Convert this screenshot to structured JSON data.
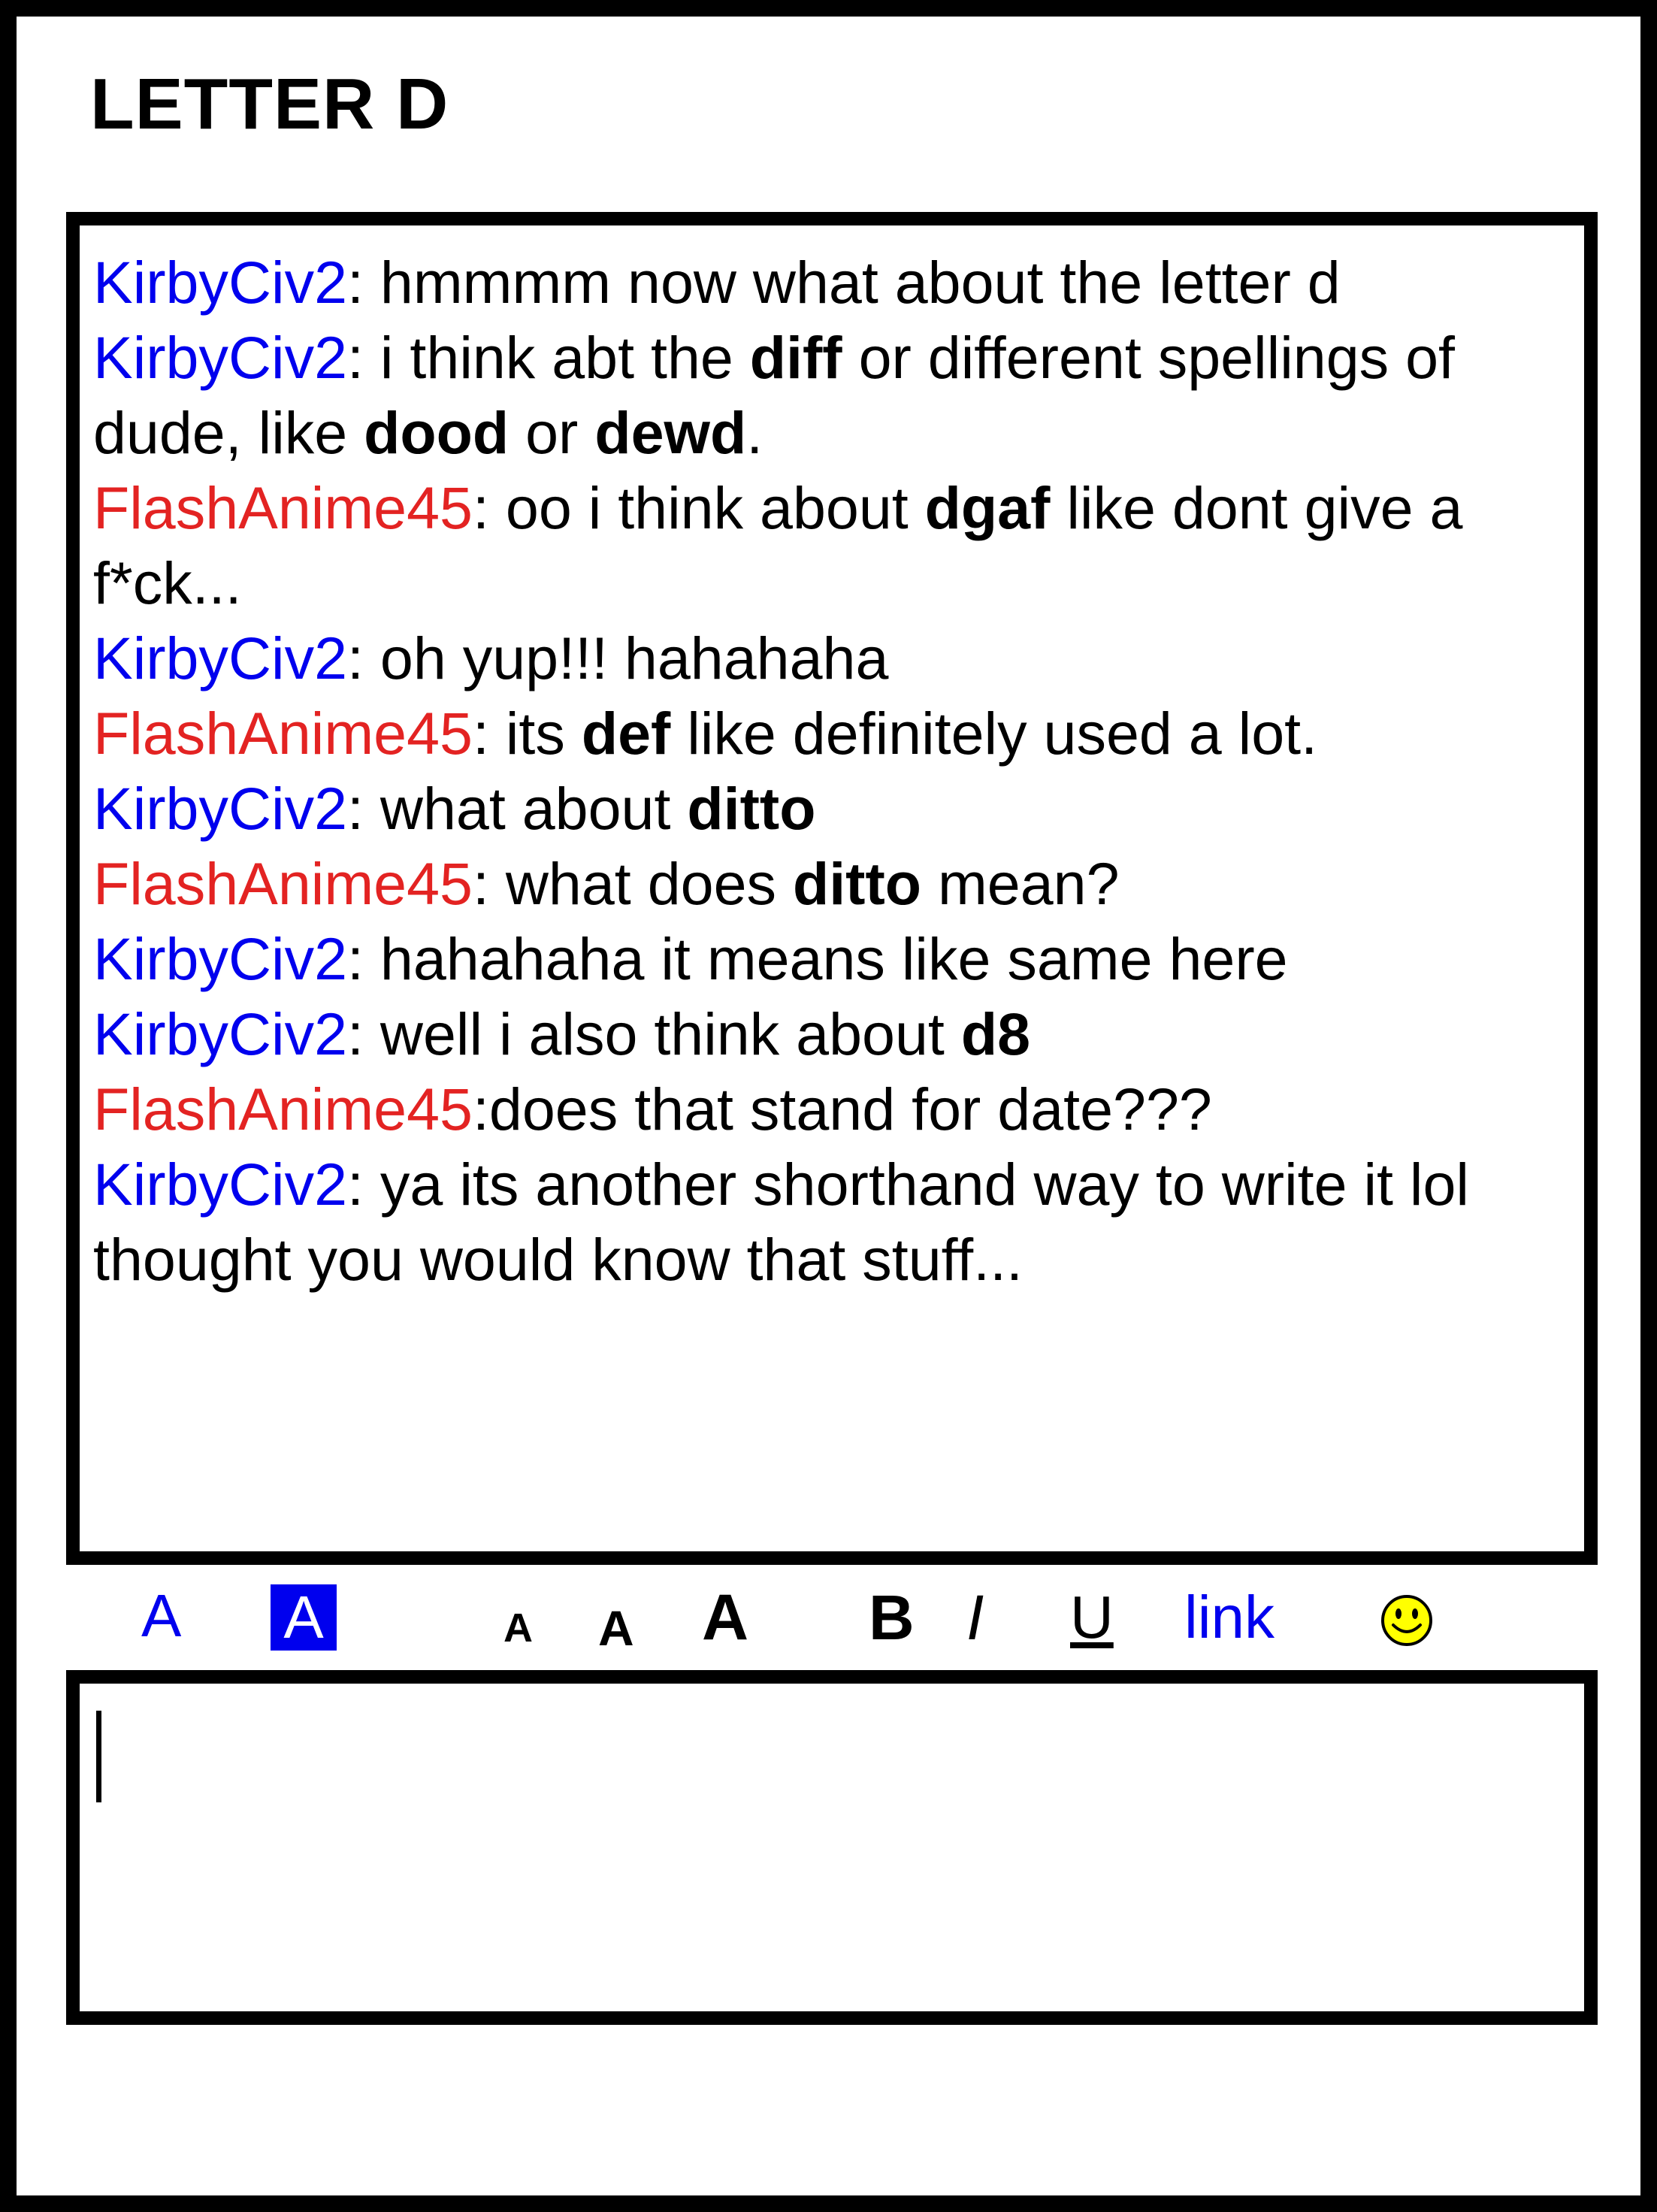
{
  "title": "LETTER D",
  "chat": {
    "messages": [
      {
        "user": "KirbyCiv2",
        "user_color": "blue",
        "segments": [
          {
            "text": ": hmmmm now what about the letter d",
            "bold": false
          }
        ]
      },
      {
        "user": "KirbyCiv2",
        "user_color": "blue",
        "segments": [
          {
            "text": ": i think abt the ",
            "bold": false
          },
          {
            "text": "diff",
            "bold": true
          },
          {
            "text": " or different spellings of",
            "bold": false
          },
          {
            "text": "\n",
            "bold": false
          },
          {
            "text": "dude, like ",
            "bold": false
          },
          {
            "text": "dood",
            "bold": true
          },
          {
            "text": " or ",
            "bold": false
          },
          {
            "text": "dewd",
            "bold": true
          },
          {
            "text": ".",
            "bold": false
          }
        ]
      },
      {
        "user": "FlashAnime45",
        "user_color": "red",
        "segments": [
          {
            "text": ": oo i think about ",
            "bold": false
          },
          {
            "text": "dgaf",
            "bold": true
          },
          {
            "text": " like dont give a",
            "bold": false
          },
          {
            "text": "\n",
            "bold": false
          },
          {
            "text": "f*ck...",
            "bold": false
          }
        ]
      },
      {
        "user": "KirbyCiv2",
        "user_color": "blue",
        "segments": [
          {
            "text": ": oh yup!!! hahahaha",
            "bold": false
          }
        ]
      },
      {
        "user": "FlashAnime45",
        "user_color": "red",
        "segments": [
          {
            "text": ": its ",
            "bold": false
          },
          {
            "text": "def",
            "bold": true
          },
          {
            "text": " like definitely used a lot.",
            "bold": false
          }
        ]
      },
      {
        "user": "KirbyCiv2",
        "user_color": "blue",
        "segments": [
          {
            "text": ": what about ",
            "bold": false
          },
          {
            "text": "ditto",
            "bold": true
          }
        ]
      },
      {
        "user": "FlashAnime45",
        "user_color": "red",
        "segments": [
          {
            "text": ": what does ",
            "bold": false
          },
          {
            "text": "ditto",
            "bold": true
          },
          {
            "text": " mean?",
            "bold": false
          }
        ]
      },
      {
        "user": "KirbyCiv2",
        "user_color": "blue",
        "segments": [
          {
            "text": ": hahahaha it means like same here",
            "bold": false
          }
        ]
      },
      {
        "user": "KirbyCiv2",
        "user_color": "blue",
        "segments": [
          {
            "text": ": well i also think about ",
            "bold": false
          },
          {
            "text": "d8",
            "bold": true
          }
        ]
      },
      {
        "user": "FlashAnime45",
        "user_color": "red",
        "segments": [
          {
            "text": ":does that stand for date???",
            "bold": false
          }
        ]
      },
      {
        "user": "KirbyCiv2",
        "user_color": "blue",
        "segments": [
          {
            "text": ": ya its another shorthand way to write it lol",
            "bold": false
          },
          {
            "text": "\n",
            "bold": false
          },
          {
            "text": "thought you would know that stuff...",
            "bold": false
          }
        ]
      }
    ]
  },
  "toolbar": {
    "text_color_label": "A",
    "bg_color_label": "A",
    "size_small_label": "A",
    "size_medium_label": "A",
    "size_large_label": "A",
    "bold_label": "B",
    "italic_label": "I",
    "underline_label": "U",
    "link_label": "link",
    "smiley_icon": "smiley-icon"
  },
  "compose": {
    "value": ""
  },
  "colors": {
    "blue": "#0000ee",
    "red": "#e32322",
    "border": "#000000",
    "smiley_yellow": "#ffff00"
  }
}
